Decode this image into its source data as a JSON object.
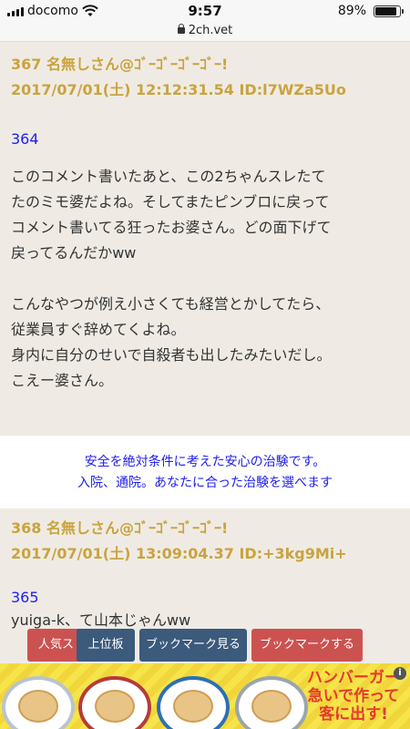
{
  "statusbar": {
    "carrier": "docomo",
    "time": "9:57",
    "battery": "89%"
  },
  "url": "2ch.vet",
  "posts": [
    {
      "header_line1": "367 名無しさん@ｺﾞｰｺﾞｰｺﾞｰｺﾞｰ!",
      "header_line2": "2017/07/01(土) 12:12:31.54 ID:l7WZa5Uo",
      "anchor": "364",
      "para1": [
        "このコメント書いたあと、この2ちゃんスレたて",
        "たのミモ婆だよね。そしてまたピンブロに戻って",
        "コメント書いてる狂ったお婆さん。どの面下げて",
        "戻ってるんだかww"
      ],
      "para2": [
        "こんなやつが例え小さくても経営とかしてたら、",
        "従業員すぐ辞めてくよね。",
        "身内に自分のせいで自殺者も出したみたいだし。",
        "こえー婆さん。"
      ]
    },
    {
      "header_line1": "368 名無しさん@ｺﾞｰｺﾞｰｺﾞｰｺﾞｰ!",
      "header_line2": "2017/07/01(土) 13:09:04.37 ID:+3kg9Mi+",
      "anchor": "365",
      "body": "yuiga-k、て山本じゃんww"
    }
  ],
  "ad_text": {
    "line1": "安全を絶対条件に考えた安心の治験です。",
    "line2": "入院、通院。あなたに合った治験を選べます"
  },
  "buttons": [
    "人気スレ",
    "上位板",
    "ブックマーク見る",
    "ブックマークする"
  ],
  "ad_banner": {
    "copy": "ハンバーガー急いで作って客に出す!",
    "info": "i"
  }
}
